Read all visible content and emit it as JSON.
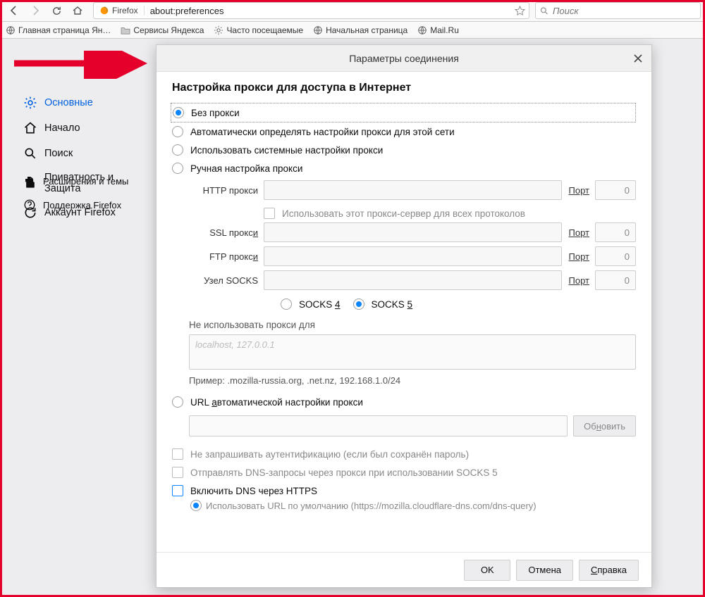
{
  "toolbar": {
    "firefox_label": "Firefox",
    "url": "about:preferences",
    "search_placeholder": "Поиск"
  },
  "bookmarks": [
    "Главная страница Ян…",
    "Сервисы Яндекса",
    "Часто посещаемые",
    "Начальная страница",
    "Mail.Ru"
  ],
  "sidebar": {
    "items": [
      "Основные",
      "Начало",
      "Поиск",
      "Приватность и\nЗащита",
      "Аккаунт Firefox"
    ],
    "extensions": "Расширения и темы",
    "support": "Поддержка Firefox"
  },
  "dialog": {
    "title": "Параметры соединения",
    "section_title": "Настройка прокси для доступа в Интернет",
    "opt_no_proxy": "Без прокси",
    "opt_auto_detect": "Автоматически определять настройки прокси для этой сети",
    "opt_system": "Использовать системные настройки прокси",
    "opt_manual": "Ручная настройка прокси",
    "http_label": "HTTP прокси",
    "ssl_label": "SSL прокси",
    "ftp_label": "FTP прокси",
    "socks_label": "Узел SOCKS",
    "port_label": "Порт",
    "port_value": "0",
    "use_for_all": "Использовать этот прокси-сервер для всех протоколов",
    "socks4": "SOCKS 4",
    "socks5": "SOCKS 5",
    "noproxy_label": "Не использовать прокси для",
    "noproxy_placeholder": "localhost, 127.0.0.1",
    "example": "Пример: .mozilla-russia.org, .net.nz, 192.168.1.0/24",
    "opt_url_auto": "URL автоматической настройки прокси",
    "reload_btn": "Обновить",
    "chk_no_auth": "Не запрашивать аутентификацию (если был сохранён пароль)",
    "chk_dns_socks5": "Отправлять DNS-запросы через прокси при использовании SOCKS 5",
    "chk_doh": "Включить DNS через HTTPS",
    "doh_default": "Использовать URL по умолчанию (https://mozilla.cloudflare-dns.com/dns-query)",
    "ok": "OK",
    "cancel": "Отмена",
    "help": "Справка"
  }
}
